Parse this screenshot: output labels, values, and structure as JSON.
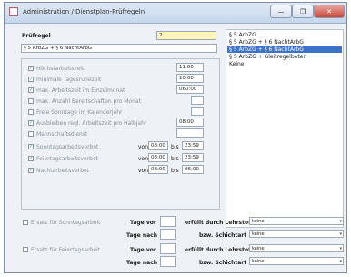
{
  "window": {
    "title": "Administration / Dienstplan-Prüfregeln",
    "minimize": "—",
    "maximize": "❐",
    "close": "✕"
  },
  "form": {
    "pruefregel_label": "Prüfregel",
    "pruefregel_value": "2",
    "name_value": "§ 5 ArbZG + § 6 NachtArbG",
    "rules": [
      {
        "label": "Höchstarbeitszeit",
        "checked": true,
        "value": "11:00"
      },
      {
        "label": "minimale Tagesruhezeit",
        "checked": true,
        "value": "10:00"
      },
      {
        "label": "max. Arbeitszeit im Einzelmonat",
        "checked": true,
        "value": "060:00"
      },
      {
        "label": "max. Anzahl Bereitschaften pro Monat",
        "checked": false,
        "value": ""
      },
      {
        "label": "Freie Sonntage im Kalenderjahr",
        "checked": false,
        "value": ""
      },
      {
        "label": "Ausbleiben regl. Arbeitszeit pro Halbjahr",
        "checked": true,
        "value": "08:00"
      },
      {
        "label": "Mannschaftsdienst",
        "checked": false,
        "value": ""
      },
      {
        "label": "Sonntagsarbeitsverbot",
        "checked": true,
        "von": "08:00",
        "bis": "23:59"
      },
      {
        "label": "Feiertagsarbeitsverbot",
        "checked": true,
        "von": "08:00",
        "bis": "23:59"
      },
      {
        "label": "Nachtarbeitsverbot",
        "checked": true,
        "von": "08:00",
        "bis": "06:00"
      }
    ],
    "von_label": "von",
    "bis_label": "bis",
    "bottom": [
      {
        "label": "Ersatz für Sonntagsarbeit",
        "tage_vor": "Tage vor",
        "tage_nach": "Tage nach",
        "erfuellt": "erfüllt durch Lehrstoff",
        "schichtart": "bzw. Schichtart",
        "combo1": "keine",
        "combo2": "keine"
      },
      {
        "label": "Ersatz für Feiertagsarbeit",
        "tage_vor": "Tage vor",
        "tage_nach": "Tage nach",
        "erfuellt": "erfüllt durch Lehrstoff",
        "schichtart": "bzw. Schichtart",
        "combo1": "keine",
        "combo2": "keine"
      }
    ]
  },
  "list": {
    "items": [
      {
        "label": "§ 5 ArbZG",
        "selected": false
      },
      {
        "label": "§ 5 ArbZG + § 6 NachtArbG",
        "selected": false
      },
      {
        "label": "§ 5 ArbZG + § 6 NachtArbG",
        "selected": true
      },
      {
        "label": "§ 5 ArbZG + Gleitregelbeter",
        "selected": false
      },
      {
        "label": "Keine",
        "selected": false
      }
    ]
  }
}
